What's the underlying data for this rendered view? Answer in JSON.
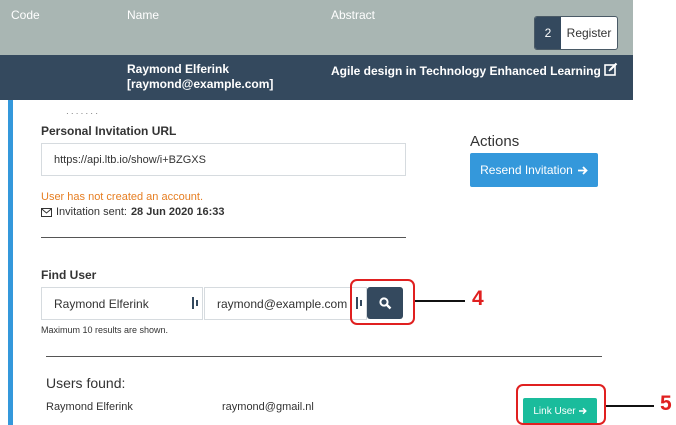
{
  "table": {
    "headers": {
      "code": "Code",
      "name": "Name",
      "abstract": "Abstract"
    },
    "register": {
      "count": "2",
      "label": "Register"
    },
    "row": {
      "name": "Raymond Elferink",
      "email": "[raymond@example.com]",
      "abstract": "Agile design in Technology Enhanced Learning"
    }
  },
  "invitation": {
    "label": "Personal Invitation URL",
    "url": "https://api.ltb.io/show/i+BZGXS",
    "warning": "User has not created an account.",
    "sent_label": "Invitation sent:",
    "sent_date": "28 Jun 2020 16:33"
  },
  "actions": {
    "title": "Actions",
    "resend_label": "Resend Invitation"
  },
  "find_user": {
    "label": "Find User",
    "name_value": "Raymond Elferink",
    "email_value": "raymond@example.com",
    "hint": "Maximum 10 results are shown."
  },
  "results": {
    "title": "Users found:",
    "rows": [
      {
        "name": "Raymond Elferink",
        "email": "raymond@gmail.nl"
      }
    ],
    "link_label": "Link User"
  },
  "annotations": [
    "4",
    "5"
  ],
  "colors": {
    "header_bg": "#a9b6b3",
    "dark": "#34495e",
    "accent_blue": "#3498db",
    "accent_green": "#1abc9c",
    "warning": "#e67e22",
    "callout": "#e02020"
  }
}
